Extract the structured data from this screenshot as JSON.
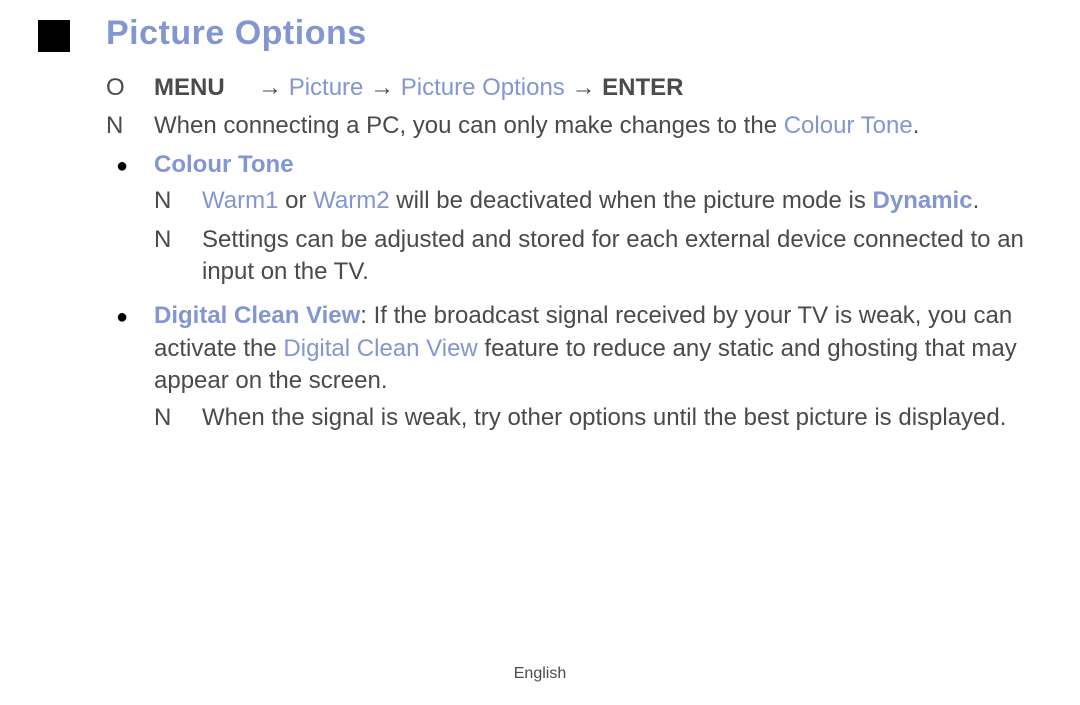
{
  "title": "Picture Options",
  "icons": {
    "O": "O",
    "N": "N",
    "bullet": "●",
    "arrow": "→"
  },
  "menu_path": {
    "menu_label": "MENU",
    "picture": "Picture",
    "picture_options": "Picture Options",
    "enter_label": "ENTER"
  },
  "note_main_prefix": "When connecting a PC, you can only make changes to the ",
  "note_main_hl": "Colour Tone",
  "note_main_suffix": ".",
  "colour_tone": {
    "heading": "Colour Tone",
    "note1_hl1": "Warm1",
    "note1_mid1": " or ",
    "note1_hl2": "Warm2",
    "note1_mid2": " will be deactivated when the picture mode is ",
    "note1_hl3": "Dynamic",
    "note1_suffix": ".",
    "note2": "Settings can be adjusted and stored for each external device connected to an input on the TV."
  },
  "digital_clean_view": {
    "heading": "Digital Clean View",
    "desc_prefix": ": If the broadcast signal received by your TV is weak, you can activate the ",
    "desc_hl": "Digital Clean View",
    "desc_suffix": " feature to reduce any static and ghosting that may appear on the screen.",
    "note1": "When the signal is weak, try other options until the best picture is displayed."
  },
  "footer": "English"
}
